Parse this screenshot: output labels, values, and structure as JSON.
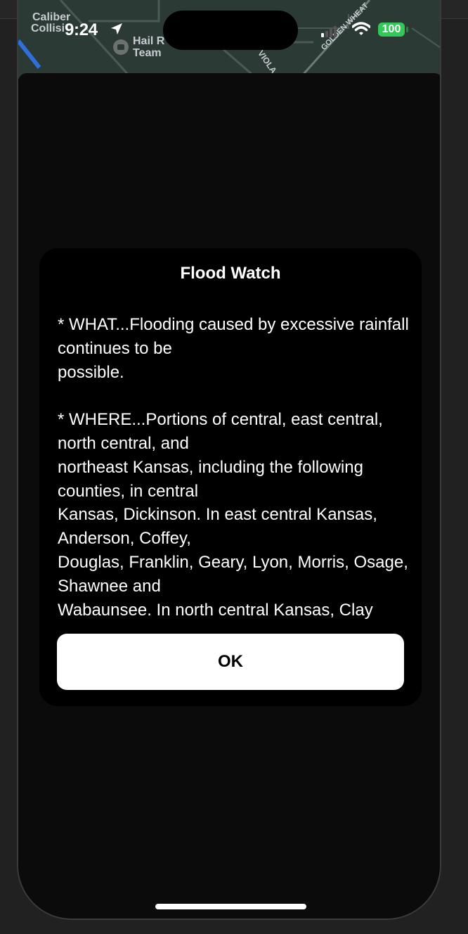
{
  "status_bar": {
    "time": "9:24",
    "battery": "100",
    "location_icon": "location-arrow-icon",
    "cell_icon": "cellular-signal-icon",
    "wifi_icon": "wifi-icon"
  },
  "map": {
    "labels": [
      "Caliber",
      "Collisi",
      "Hail R",
      "Team",
      "VIOLA",
      "GOLDEN WHEAT"
    ],
    "pin_icon": "car-repair-icon"
  },
  "dialog": {
    "title": "Flood Watch",
    "body": "* WHAT...Flooding caused by excessive rainfall continues to be\npossible.\n\n* WHERE...Portions of central, east central, north central, and\nnortheast Kansas, including the following counties, in central\nKansas, Dickinson. In east central Kansas, Anderson, Coffey,\nDouglas, Franklin, Geary, Lyon, Morris, Osage, Shawnee and\nWabaunsee. In north central Kansas, Clay",
    "ok_label": "OK"
  },
  "colors": {
    "battery": "#34c759",
    "sheet_background": "#0b0b0c",
    "dialog_background": "#000000",
    "button_background": "#ffffff"
  }
}
